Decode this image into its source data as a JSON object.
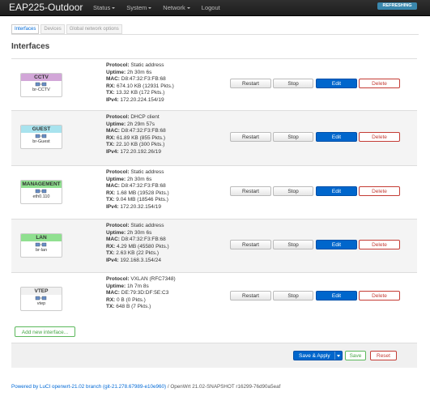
{
  "header": {
    "brand": "EAP225-Outdoor",
    "menu": [
      {
        "label": "Status",
        "dropdown": true
      },
      {
        "label": "System",
        "dropdown": true
      },
      {
        "label": "Network",
        "dropdown": true
      },
      {
        "label": "Logout",
        "dropdown": false
      }
    ],
    "refresh_badge": "REFRESHING"
  },
  "tabs": [
    "Interfaces",
    "Devices",
    "Global network options"
  ],
  "page_title": "Interfaces",
  "interfaces": [
    {
      "name": "CCTV",
      "color": "#d2a6d8",
      "device": "br-CCTV",
      "lines": [
        {
          "k": "Protocol:",
          "v": "Static address"
        },
        {
          "k": "Uptime:",
          "v": "2h 30m 6s"
        },
        {
          "k": "MAC:",
          "v": "D8:47:32:F3:FB:68"
        },
        {
          "k": "RX:",
          "v": "674.10 KB (12931 Pkts.)"
        },
        {
          "k": "TX:",
          "v": "13.32 KB (172 Pkts.)"
        },
        {
          "k": "IPv4:",
          "v": "172.20.224.154/19"
        }
      ]
    },
    {
      "name": "GUEST",
      "color": "#a8e3ee",
      "device": "br-Guest",
      "lines": [
        {
          "k": "Protocol:",
          "v": "DHCP client"
        },
        {
          "k": "Uptime:",
          "v": "2h 29m 57s"
        },
        {
          "k": "MAC:",
          "v": "D8:47:32:F3:FB:68"
        },
        {
          "k": "RX:",
          "v": "61.89 KB (855 Pkts.)"
        },
        {
          "k": "TX:",
          "v": "22.10 KB (300 Pkts.)"
        },
        {
          "k": "IPv4:",
          "v": "172.20.192.26/19"
        }
      ]
    },
    {
      "name": "MANAGEMENT",
      "color": "#90e090",
      "device": "eth0.110",
      "lines": [
        {
          "k": "Protocol:",
          "v": "Static address"
        },
        {
          "k": "Uptime:",
          "v": "2h 30m 6s"
        },
        {
          "k": "MAC:",
          "v": "D8:47:32:F3:FB:68"
        },
        {
          "k": "RX:",
          "v": "1.68 MB (19528 Pkts.)"
        },
        {
          "k": "TX:",
          "v": "9.04 MB (18546 Pkts.)"
        },
        {
          "k": "IPv4:",
          "v": "172.20.32.154/19"
        }
      ]
    },
    {
      "name": "LAN",
      "color": "#90e090",
      "device": "br-lan",
      "lines": [
        {
          "k": "Protocol:",
          "v": "Static address"
        },
        {
          "k": "Uptime:",
          "v": "2h 30m 6s"
        },
        {
          "k": "MAC:",
          "v": "D8:47:32:F3:FB:68"
        },
        {
          "k": "RX:",
          "v": "4.29 MB (45580 Pkts.)"
        },
        {
          "k": "TX:",
          "v": "2.63 KB (22 Pkts.)"
        },
        {
          "k": "IPv4:",
          "v": "192.168.3.154/24"
        }
      ]
    },
    {
      "name": "VTEP",
      "color": "#f0f0f0",
      "device": "vtep",
      "lines": [
        {
          "k": "Protocol:",
          "v": "VXLAN (RFC7348)"
        },
        {
          "k": "Uptime:",
          "v": "1h 7m 8s"
        },
        {
          "k": "MAC:",
          "v": "DE:79:3D:DF:5E:C3"
        },
        {
          "k": "RX:",
          "v": "0 B (0 Pkts.)"
        },
        {
          "k": "TX:",
          "v": "648 B (7 Pkts.)"
        }
      ]
    }
  ],
  "row_buttons": {
    "restart": "Restart",
    "stop": "Stop",
    "edit": "Edit",
    "delete": "Delete"
  },
  "add_interface": "Add new interface...",
  "actions": {
    "save_apply": "Save & Apply",
    "save": "Save",
    "reset": "Reset"
  },
  "footer": {
    "link": "Powered by LuCI openwrt-21.02 branch (git-21.278.67989-e10e960)",
    "text": " / OpenWrt 21.02-SNAPSHOT r16299-76d90a5eaf"
  }
}
